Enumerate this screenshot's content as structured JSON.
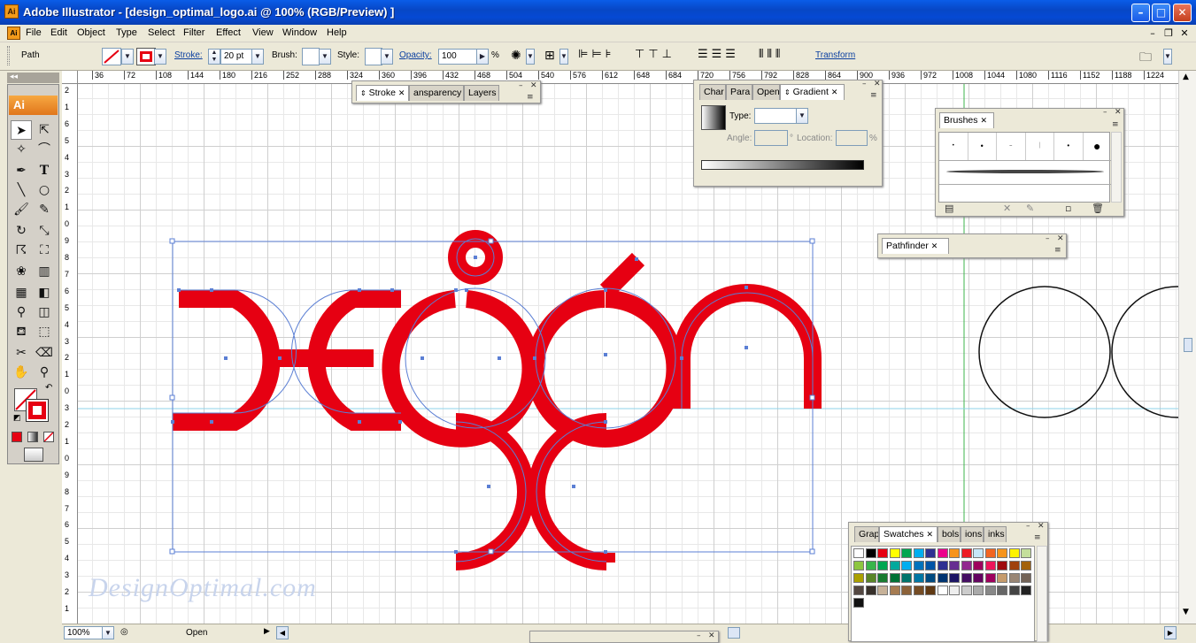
{
  "window": {
    "title": "Adobe Illustrator - [design_optimal_logo.ai @ 100% (RGB/Preview) ]",
    "icon_text": "Ai",
    "buttons": [
      "minimize-icon",
      "maximize-icon",
      "close-icon"
    ]
  },
  "menu": [
    "File",
    "Edit",
    "Object",
    "Type",
    "Select",
    "Filter",
    "Effect",
    "View",
    "Window",
    "Help"
  ],
  "control": {
    "selection": "Path",
    "stroke_label": "Stroke:",
    "stroke_value": "20 pt",
    "brush_label": "Brush:",
    "style_label": "Style:",
    "opacity_label": "Opacity:",
    "opacity_value": "100",
    "percent": "%",
    "transform_label": "Transform",
    "fill_color": "#ffffff",
    "stroke_color": "#e60012"
  },
  "rulers": {
    "top": [
      "36",
      "72",
      "108",
      "144",
      "180",
      "216",
      "252",
      "288",
      "324",
      "360",
      "396",
      "432",
      "468",
      "504",
      "540",
      "576",
      "612",
      "648",
      "684",
      "720",
      "756",
      "792",
      "828",
      "864",
      "900",
      "936",
      "972",
      "1008",
      "1044",
      "1080",
      "1116",
      "1152",
      "1188",
      "1224"
    ],
    "left": [
      "2",
      "1",
      "6",
      "5",
      "4",
      "3",
      "2",
      "1",
      "0",
      "9",
      "8",
      "7",
      "6",
      "5",
      "4",
      "3",
      "2",
      "1",
      "0",
      "3",
      "2",
      "1",
      "0",
      "9",
      "8",
      "7",
      "6",
      "5",
      "4",
      "3",
      "2",
      "1"
    ]
  },
  "toolbox": {
    "logo": "Ai"
  },
  "panels": {
    "stroke_group": {
      "tabs": [
        "Stroke",
        "ansparency",
        "Layers"
      ]
    },
    "gradient": {
      "tabs": [
        "Char",
        "Para",
        "Open",
        "Gradient"
      ],
      "type_label": "Type:",
      "angle_label": "Angle:",
      "location_label": "Location:",
      "degree": "°",
      "percent": "%"
    },
    "brushes": {
      "tab": "Brushes"
    },
    "pathfinder": {
      "tab": "Pathfinder"
    },
    "swatches": {
      "tabs": [
        "Grap",
        "Swatches",
        "bols",
        "ions",
        "inks"
      ]
    },
    "bottom": {
      "tab": ""
    }
  },
  "status": {
    "zoom": "100%",
    "status_text": "Open"
  },
  "artwork": {
    "logo_color": "#e60012",
    "watermark": "DesignOptimal.com"
  },
  "swatch_colors": [
    "#ffffff",
    "#000000",
    "#e60012",
    "#ffff00",
    "#00a650",
    "#00aeef",
    "#2e3192",
    "#ec008c",
    "#f7941d",
    "#ed1c24",
    "#c6e7f8",
    "#f26522",
    "#f7941d",
    "#fff200",
    "#c4df9b",
    "#8dc63f",
    "#39b54a",
    "#00a651",
    "#00a99d",
    "#00aeef",
    "#0072bc",
    "#0054a6",
    "#2e3192",
    "#662d91",
    "#92278f",
    "#9e005d",
    "#ed145b",
    "#9e0b0f",
    "#a0410d",
    "#a3620a",
    "#aba000",
    "#598527",
    "#197b30",
    "#007236",
    "#00746b",
    "#0076a3",
    "#004a80",
    "#003471",
    "#1b1464",
    "#440e62",
    "#630460",
    "#9e005d",
    "#c69c6d",
    "#998675",
    "#736357",
    "#534741",
    "#37302a",
    "#c7b299",
    "#a67c52",
    "#8c6239",
    "#754c24",
    "#603913",
    "#ffffff",
    "#eeeeee",
    "#cccccc",
    "#aaaaaa",
    "#888888",
    "#666666",
    "#444444",
    "#222222",
    "#111111"
  ]
}
